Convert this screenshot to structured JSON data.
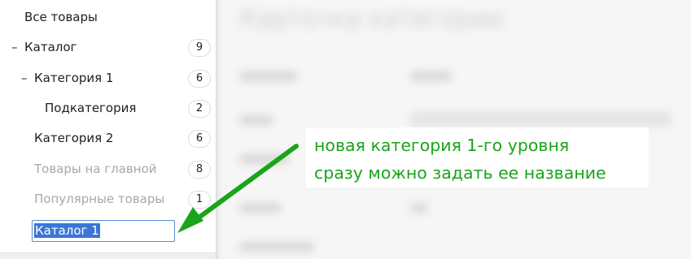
{
  "sidebar": {
    "all_products": "Все товары",
    "items": [
      {
        "label": "Каталог",
        "count": "9",
        "collapse": "–"
      },
      {
        "label": "Категория 1",
        "count": "6",
        "collapse": "–"
      },
      {
        "label": "Подкатегория",
        "count": "2"
      },
      {
        "label": "Категория 2",
        "count": "6"
      },
      {
        "label": "Товары на главной",
        "count": "8"
      },
      {
        "label": "Популярные товары",
        "count": "1"
      }
    ],
    "new_item_value": "Каталог 1"
  },
  "main": {
    "title_blurred": "Карточка категории"
  },
  "annotation": {
    "line1": "новая категория 1-го уровня",
    "line2": "сразу можно задать ее название",
    "color": "#1aa41a"
  }
}
